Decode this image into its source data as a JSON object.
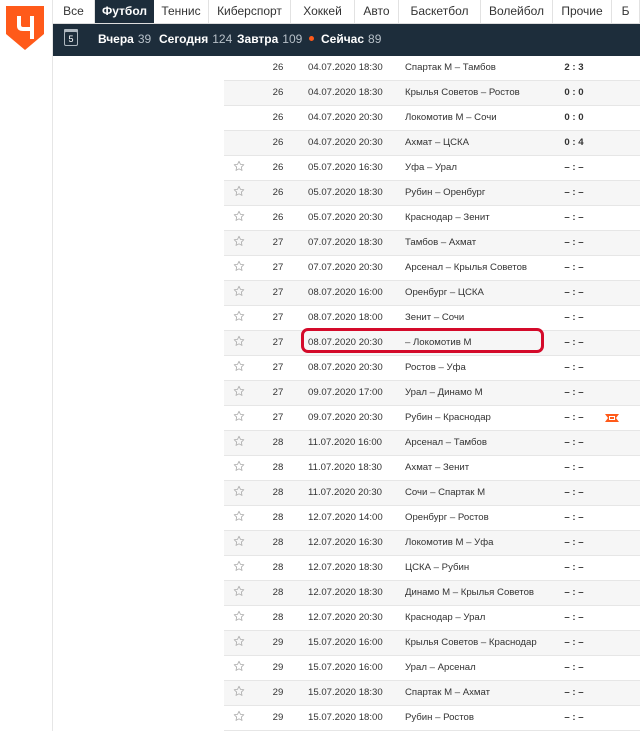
{
  "sport_tabs": [
    {
      "label": "Все"
    },
    {
      "label": "Футбол",
      "active": true
    },
    {
      "label": "Теннис"
    },
    {
      "label": "Киберспорт"
    },
    {
      "label": "Хоккей"
    },
    {
      "label": "Авто"
    },
    {
      "label": "Баскетбол"
    },
    {
      "label": "Волейбол"
    },
    {
      "label": "Прочие"
    },
    {
      "label": "Б"
    }
  ],
  "calendar_day": "5",
  "days": {
    "yesterday": {
      "label": "Вчера",
      "count": "39"
    },
    "today": {
      "label": "Сегодня",
      "count": "124"
    },
    "tomorrow": {
      "label": "Завтра",
      "count": "109"
    },
    "now": {
      "label": "Сейчас",
      "count": "89"
    }
  },
  "colors": {
    "nav_dark": "#1d2d3b",
    "accent": "#ff5a1a",
    "highlight": "#d40a2a"
  },
  "matches": [
    {
      "tour": "26",
      "date": "04.07.2020",
      "time": "18:30",
      "teams": "Спартак М – Тамбов",
      "score": "2 : 3",
      "star": false
    },
    {
      "tour": "26",
      "date": "04.07.2020",
      "time": "18:30",
      "teams": "Крылья Советов – Ростов",
      "score": "0 : 0",
      "star": false
    },
    {
      "tour": "26",
      "date": "04.07.2020",
      "time": "20:30",
      "teams": "Локомотив М – Сочи",
      "score": "0 : 0",
      "star": false
    },
    {
      "tour": "26",
      "date": "04.07.2020",
      "time": "20:30",
      "teams": "Ахмат – ЦСКА",
      "score": "0 : 4",
      "star": false
    },
    {
      "tour": "26",
      "date": "05.07.2020",
      "time": "16:30",
      "teams": "Уфа – Урал",
      "score": "– : –",
      "star": true
    },
    {
      "tour": "26",
      "date": "05.07.2020",
      "time": "18:30",
      "teams": "Рубин – Оренбург",
      "score": "– : –",
      "star": true
    },
    {
      "tour": "26",
      "date": "05.07.2020",
      "time": "20:30",
      "teams": "Краснодар – Зенит",
      "score": "– : –",
      "star": true
    },
    {
      "tour": "27",
      "date": "07.07.2020",
      "time": "18:30",
      "teams": "Тамбов – Ахмат",
      "score": "– : –",
      "star": true
    },
    {
      "tour": "27",
      "date": "07.07.2020",
      "time": "20:30",
      "teams": "Арсенал – Крылья Советов",
      "score": "– : –",
      "star": true
    },
    {
      "tour": "27",
      "date": "08.07.2020",
      "time": "16:00",
      "teams": "Оренбург – ЦСКА",
      "score": "– : –",
      "star": true
    },
    {
      "tour": "27",
      "date": "08.07.2020",
      "time": "18:00",
      "teams": "Зенит – Сочи",
      "score": "– : –",
      "star": true
    },
    {
      "tour": "27",
      "date": "08.07.2020",
      "time": "20:30",
      "teams": "– Локомотив М",
      "score": "– : –",
      "star": true
    },
    {
      "tour": "27",
      "date": "08.07.2020",
      "time": "20:30",
      "teams": "Ростов – Уфа",
      "score": "– : –",
      "star": true
    },
    {
      "tour": "27",
      "date": "09.07.2020",
      "time": "17:00",
      "teams": "Урал – Динамо М",
      "score": "– : –",
      "star": true
    },
    {
      "tour": "27",
      "date": "09.07.2020",
      "time": "20:30",
      "teams": "Рубин – Краснодар",
      "score": "– : –",
      "star": true,
      "tv": true
    },
    {
      "tour": "28",
      "date": "11.07.2020",
      "time": "16:00",
      "teams": "Арсенал – Тамбов",
      "score": "– : –",
      "star": true
    },
    {
      "tour": "28",
      "date": "11.07.2020",
      "time": "18:30",
      "teams": "Ахмат – Зенит",
      "score": "– : –",
      "star": true
    },
    {
      "tour": "28",
      "date": "11.07.2020",
      "time": "20:30",
      "teams": "Сочи – Спартак М",
      "score": "– : –",
      "star": true
    },
    {
      "tour": "28",
      "date": "12.07.2020",
      "time": "14:00",
      "teams": "Оренбург – Ростов",
      "score": "– : –",
      "star": true
    },
    {
      "tour": "28",
      "date": "12.07.2020",
      "time": "16:30",
      "teams": "Локомотив М – Уфа",
      "score": "– : –",
      "star": true
    },
    {
      "tour": "28",
      "date": "12.07.2020",
      "time": "18:30",
      "teams": "ЦСКА – Рубин",
      "score": "– : –",
      "star": true
    },
    {
      "tour": "28",
      "date": "12.07.2020",
      "time": "18:30",
      "teams": "Динамо М – Крылья Советов",
      "score": "– : –",
      "star": true
    },
    {
      "tour": "28",
      "date": "12.07.2020",
      "time": "20:30",
      "teams": "Краснодар – Урал",
      "score": "– : –",
      "star": true
    },
    {
      "tour": "29",
      "date": "15.07.2020",
      "time": "16:00",
      "teams": "Крылья Советов – Краснодар",
      "score": "– : –",
      "star": true
    },
    {
      "tour": "29",
      "date": "15.07.2020",
      "time": "16:00",
      "teams": "Урал – Арсенал",
      "score": "– : –",
      "star": true
    },
    {
      "tour": "29",
      "date": "15.07.2020",
      "time": "18:30",
      "teams": "Спартак М – Ахмат",
      "score": "– : –",
      "star": true
    },
    {
      "tour": "29",
      "date": "15.07.2020",
      "time": "18:00",
      "teams": "Рубин – Ростов",
      "score": "– : –",
      "star": true
    }
  ]
}
